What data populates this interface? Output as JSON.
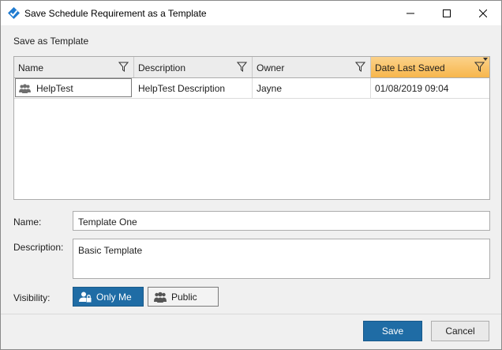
{
  "window": {
    "title": "Save Schedule Requirement as a Template"
  },
  "section": {
    "label": "Save as Template"
  },
  "grid": {
    "columns": [
      {
        "label": "Name"
      },
      {
        "label": "Description"
      },
      {
        "label": "Owner"
      },
      {
        "label": "Date Last Saved"
      }
    ],
    "rows": [
      {
        "name": "HelpTest",
        "description": "HelpTest Description",
        "owner": "Jayne",
        "date": "01/08/2019 09:04"
      }
    ],
    "active_column_color": "#f7b64c"
  },
  "form": {
    "name_label": "Name:",
    "name_value": "Template One",
    "description_label": "Description:",
    "description_value": "Basic Template",
    "visibility_label": "Visibility:",
    "visibility_options": [
      {
        "label": "Only Me",
        "icon": "user-lock-icon",
        "selected": true
      },
      {
        "label": "Public",
        "icon": "users-icon",
        "selected": false
      }
    ]
  },
  "footer": {
    "save_label": "Save",
    "cancel_label": "Cancel"
  },
  "colors": {
    "accent": "#1f6ca5"
  }
}
